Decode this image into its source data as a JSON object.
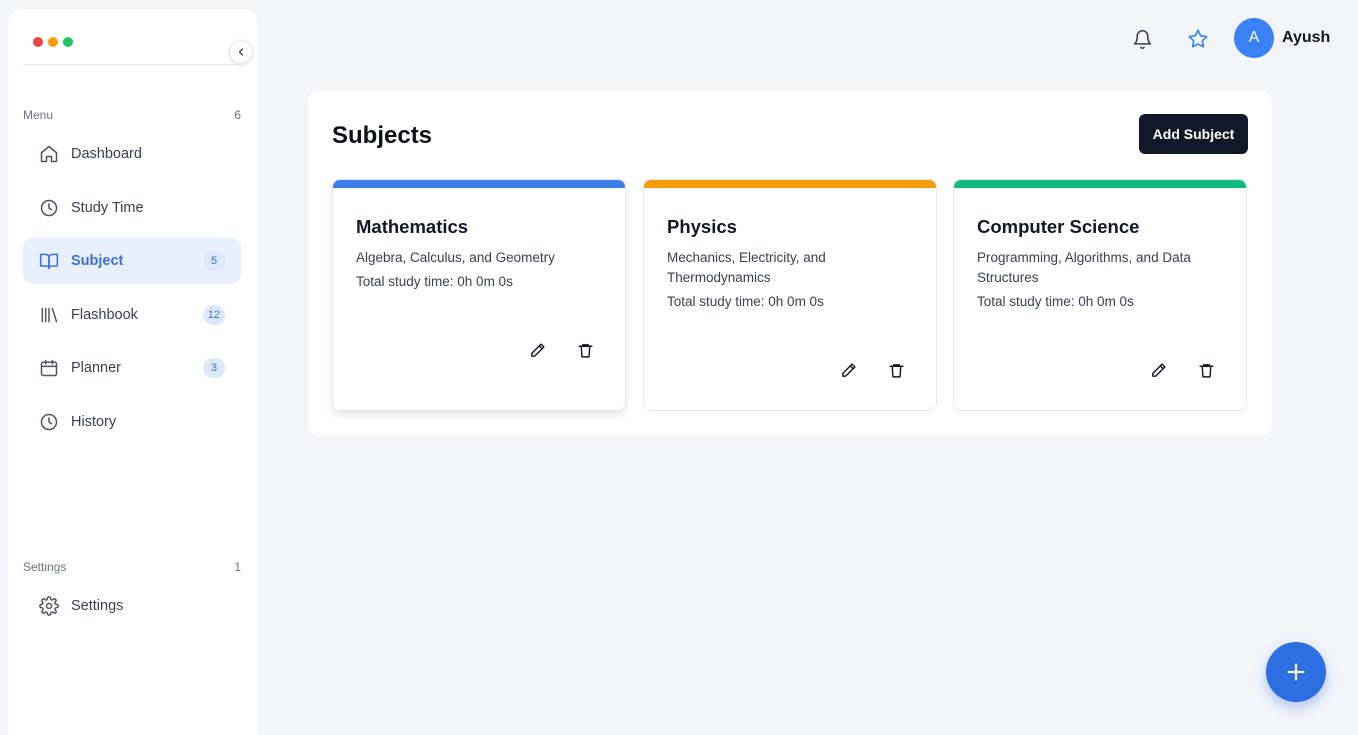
{
  "window": {
    "traffic_lights": [
      "#ef4444",
      "#f59e0b",
      "#22c55e"
    ]
  },
  "sidebar": {
    "menu_label": "Menu",
    "menu_count": "6",
    "items": [
      {
        "label": "Dashboard",
        "icon": "home-icon",
        "badge": ""
      },
      {
        "label": "Study Time",
        "icon": "clock-icon",
        "badge": ""
      },
      {
        "label": "Subject",
        "icon": "book-open-icon",
        "badge": "5",
        "active": true
      },
      {
        "label": "Flashbook",
        "icon": "library-icon",
        "badge": "12"
      },
      {
        "label": "Planner",
        "icon": "calendar-icon",
        "badge": "3"
      },
      {
        "label": "History",
        "icon": "clock-icon",
        "badge": ""
      }
    ],
    "settings_label": "Settings",
    "settings_count": "1",
    "settings_items": [
      {
        "label": "Settings",
        "icon": "gear-icon"
      }
    ]
  },
  "header": {
    "avatar_initial": "A",
    "username": "Ayush",
    "accent": "#3b82f6"
  },
  "main": {
    "title": "Subjects",
    "add_button_label": "Add Subject",
    "cards": [
      {
        "title": "Mathematics",
        "description": "Algebra, Calculus, and Geometry",
        "time": "Total study time: 0h 0m 0s",
        "color": "#3b7de9"
      },
      {
        "title": "Physics",
        "description": "Mechanics, Electricity, and Thermodynamics",
        "time": "Total study time: 0h 0m 0s",
        "color": "#f59e0b"
      },
      {
        "title": "Computer Science",
        "description": "Programming, Algorithms, and Data Structures",
        "time": "Total study time: 0h 0m 0s",
        "color": "#10b981"
      }
    ]
  },
  "fab": {
    "icon": "plus-icon"
  }
}
